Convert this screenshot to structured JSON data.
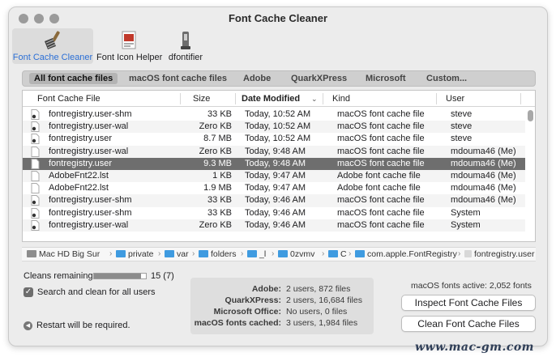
{
  "window": {
    "title": "Font Cache Cleaner"
  },
  "toolbar": [
    {
      "label": "Font Cache Cleaner",
      "icon": "broom-icon",
      "active": true
    },
    {
      "label": "Font Icon Helper",
      "icon": "font-doc-icon",
      "active": false
    },
    {
      "label": "dfontifier",
      "icon": "dfont-tool-icon",
      "active": false
    }
  ],
  "tabs": [
    "All font cache files",
    "macOS font cache files",
    "Adobe",
    "QuarkXPress",
    "Microsoft",
    "Custom..."
  ],
  "table": {
    "columns": [
      "Font Cache File",
      "Size",
      "Date Modified",
      "Kind",
      "User"
    ],
    "rows": [
      {
        "name": "fontregistry.user-shm",
        "size": "33 KB",
        "date": "Today, 10:52 AM",
        "kind": "macOS font cache file",
        "user": "steve"
      },
      {
        "name": "fontregistry.user-wal",
        "size": "Zero KB",
        "date": "Today, 10:52 AM",
        "kind": "macOS font cache file",
        "user": "steve"
      },
      {
        "name": "fontregistry.user",
        "size": "8.7 MB",
        "date": "Today, 10:52 AM",
        "kind": "macOS font cache file",
        "user": "steve"
      },
      {
        "name": "fontregistry.user-wal",
        "size": "Zero KB",
        "date": "Today, 9:48 AM",
        "kind": "macOS font cache file",
        "user": "mdouma46 (Me)"
      },
      {
        "name": "fontregistry.user",
        "size": "9.3 MB",
        "date": "Today, 9:48 AM",
        "kind": "macOS font cache file",
        "user": "mdouma46 (Me)"
      },
      {
        "name": "AdobeFnt22.lst",
        "size": "1 KB",
        "date": "Today, 9:47 AM",
        "kind": "Adobe font cache file",
        "user": "mdouma46 (Me)"
      },
      {
        "name": "AdobeFnt22.lst",
        "size": "1.9 MB",
        "date": "Today, 9:47 AM",
        "kind": "Adobe font cache file",
        "user": "mdouma46 (Me)"
      },
      {
        "name": "fontregistry.user-shm",
        "size": "33 KB",
        "date": "Today, 9:46 AM",
        "kind": "macOS font cache file",
        "user": "mdouma46 (Me)"
      },
      {
        "name": "fontregistry.user-shm",
        "size": "33 KB",
        "date": "Today, 9:46 AM",
        "kind": "macOS font cache file",
        "user": "System"
      },
      {
        "name": "fontregistry.user-wal",
        "size": "Zero KB",
        "date": "Today, 9:46 AM",
        "kind": "macOS font cache file",
        "user": "System"
      }
    ]
  },
  "path": [
    "Mac HD Big Sur",
    "private",
    "var",
    "folders",
    "_l",
    "0zvmv",
    "C",
    "com.apple.FontRegistry",
    "fontregistry.user"
  ],
  "status": {
    "cleans_label": "Cleans remaining:",
    "cleans_value": "15 (7)",
    "cleans_fraction": 0.9,
    "checkbox_label": "Search and clean for all users",
    "checkbox_checked": true,
    "restart_text": "Restart will be required."
  },
  "stats": [
    {
      "label": "Adobe:",
      "value": "2 users, 872 files"
    },
    {
      "label": "QuarkXPress:",
      "value": "2 users, 16,684 files"
    },
    {
      "label": "Microsoft Office:",
      "value": "No users, 0 files"
    },
    {
      "label": "macOS fonts cached:",
      "value": "3 users, 1,984 files"
    }
  ],
  "active_fonts": "macOS fonts active: 2,052 fonts",
  "buttons": {
    "inspect": "Inspect Font Cache Files",
    "clean": "Clean Font Cache Files"
  },
  "watermark": "www.mac-gm.com",
  "colors": {
    "accent": "#2b6fd6",
    "selection": "#6e6e6e",
    "folder": "#3f9be0"
  }
}
